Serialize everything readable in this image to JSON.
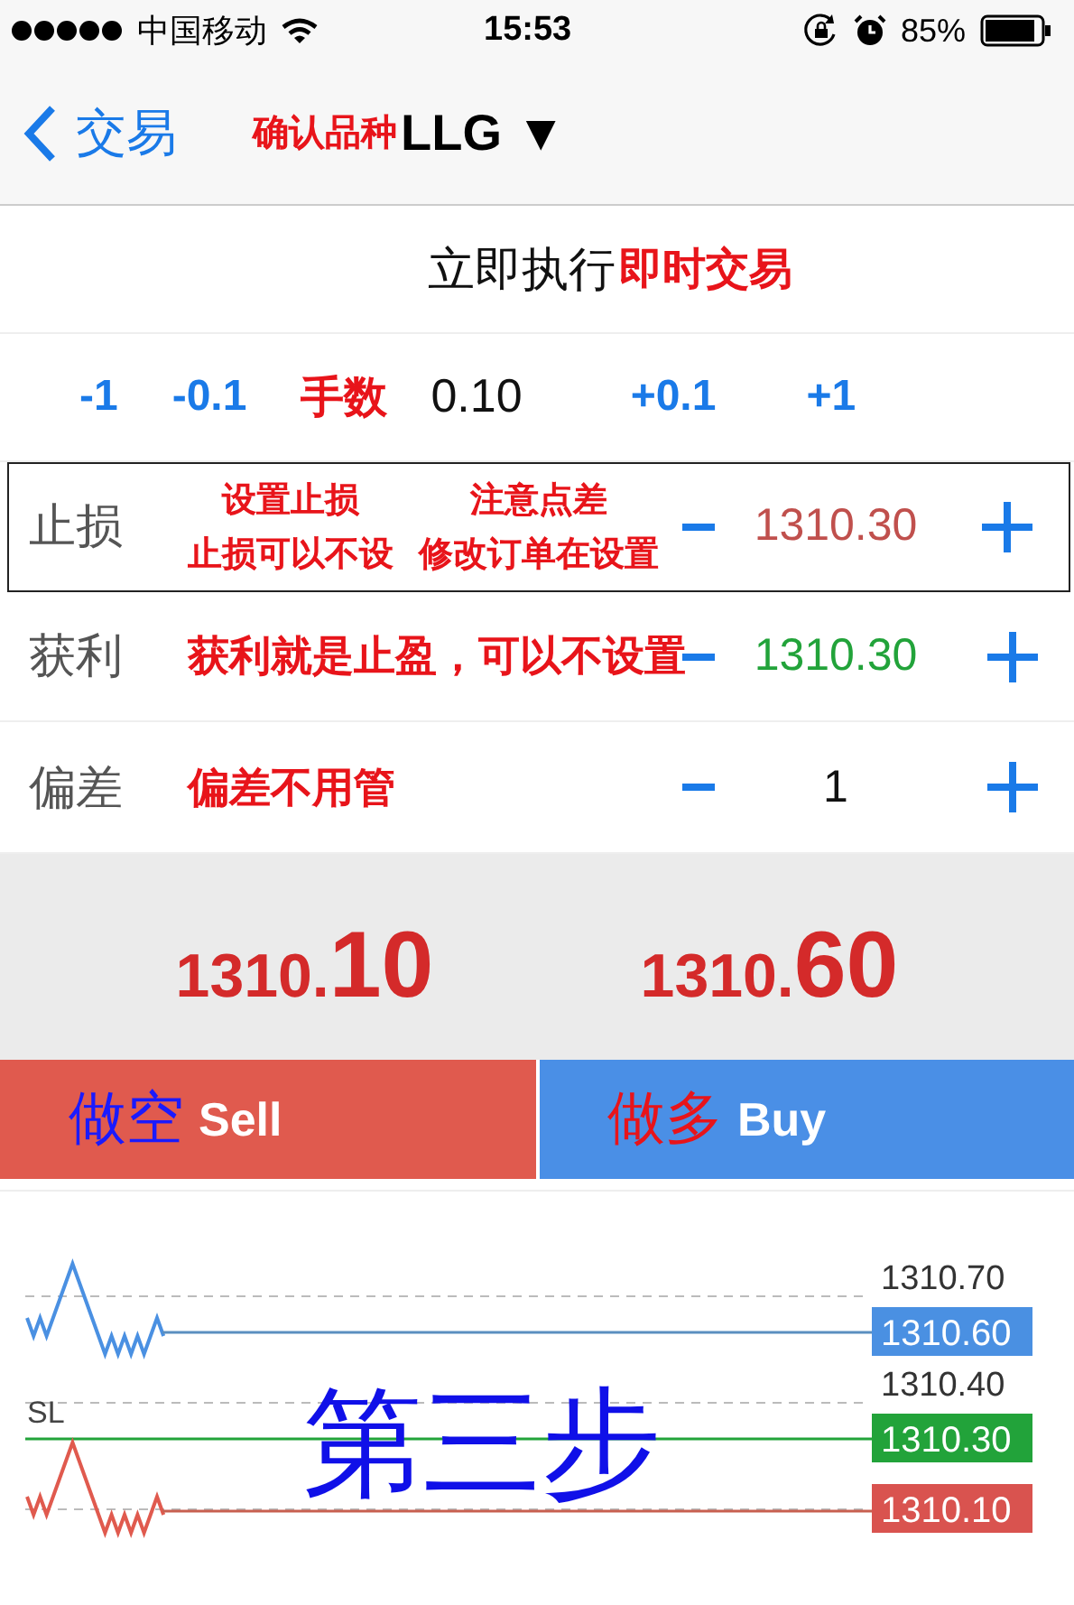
{
  "status_bar": {
    "carrier": "中国移动",
    "time": "15:53",
    "battery": "85%"
  },
  "nav": {
    "back": "交易",
    "note": "确认品种",
    "symbol": "LLG",
    "dropdown": "▼"
  },
  "execution": {
    "title": "立即执行",
    "note": "即时交易"
  },
  "volume": {
    "decrease": [
      "-1",
      "-0.1"
    ],
    "note": "手数",
    "value": "0.10",
    "increase": [
      "+0.1",
      "+1"
    ]
  },
  "fields": [
    {
      "label": "止损",
      "notes": [
        [
          "设置止损",
          "止损可以不设"
        ],
        [
          "注意点差",
          "修改订单在设置"
        ]
      ],
      "value": "1310.30",
      "color": "#c0504d",
      "boxed": true
    },
    {
      "label": "获利",
      "notes": [
        [
          "获利就是止盈，可以不设置"
        ]
      ],
      "value": "1310.30",
      "color": "#22a33a",
      "boxed": false
    },
    {
      "label": "偏差",
      "notes": [
        [
          "偏差不用管"
        ]
      ],
      "value": "1",
      "color": "#111111",
      "boxed": false
    }
  ],
  "prices": [
    {
      "main": "1310.",
      "big": "10"
    },
    {
      "main": "1310.",
      "big": "60"
    }
  ],
  "actions": [
    {
      "kind": "sell",
      "note": "做空",
      "label": "Sell"
    },
    {
      "kind": "buy",
      "note": "做多",
      "label": "Buy"
    }
  ],
  "chart": {
    "grid_labels": [
      "1310.70",
      "1310.40"
    ],
    "marker": "SL",
    "note": "第三步",
    "tags": [
      {
        "label": "1310.60",
        "color": "#4a90e2"
      },
      {
        "label": "1310.30",
        "color": "#22a33a"
      },
      {
        "label": "1310.10",
        "color": "#d9534f"
      }
    ]
  }
}
